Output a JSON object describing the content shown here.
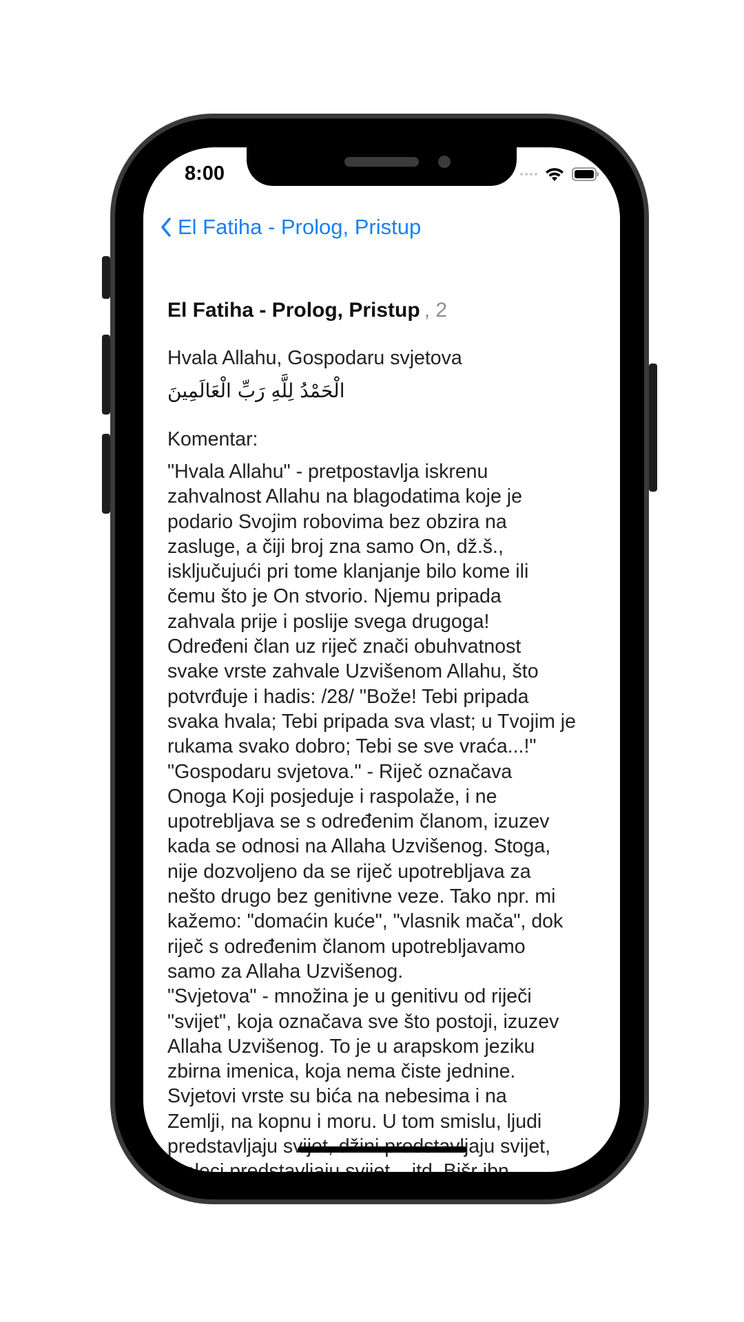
{
  "status_bar": {
    "time": "8:00"
  },
  "nav": {
    "back_label": "El Fatiha - Prolog, Pristup"
  },
  "verse": {
    "title": "El Fatiha - Prolog, Pristup",
    "number": ", 2",
    "translation": "Hvala Allahu, Gospodaru svjetova",
    "arabic": "الْحَمْدُ لِلَّهِ رَبِّ الْعَالَمِينَ"
  },
  "commentary": {
    "label": "Komentar:",
    "text": "\"Hvala Allahu\" - pretpostavlja iskrenu\nzahvalnost Allahu na blagodatima koje je\npodario Svojim robovima bez obzira na\nzasluge, a čiji broj zna samo On, dž.š.,\nisključujući pri tome klanjanje bilo kome ili\nčemu što je On stvorio. Njemu pripada\nzahvala prije i poslije svega drugoga!\nOdređeni član uz riječ  znači obuhvatnost\nsvake vrste zahvale Uzvišenom Allahu, što\npotvrđuje i hadis: /28/ \"Bože! Tebi pripada\nsvaka hvala; Tebi pripada sva vlast; u Tvojim je\nrukama svako dobro; Tebi se sve vraća...!\"\n\"Gospodaru svjetova.\" - Riječ  označava\nOnoga Koji posjeduje i raspolaže, i ne\nupotrebljava se s određenim članom, izuzev\nkada se odnosi na Allaha Uzvišenog. Stoga,\nnije dozvoljeno da se riječ  upotrebljava za\nnešto drugo bez genitivne veze. Tako npr. mi\nkažemo: \"domaćin kuće\", \"vlasnik mača\", dok\nriječ s određenim članom upotrebljavamo\nsamo za Allaha Uzvišenog.\n\"Svjetova\" - množina je u genitivu od riječi\n\"svijet\", koja označava sve što postoji, izuzev\nAllaha Uzvišenog. To je u arapskom jeziku\nzbirna imenica, koja nema čiste jednine.\nSvjetovi  vrste su bića na nebesima i na\nZemlji, na kopnu i moru. U tom smislu, ljudi\npredstavljaju svijet, džini predstavljaju svijet,\nmeleci  predstavljaju svijet... itd. Bišr ibn"
  },
  "colors": {
    "accent": "#1a7ff0",
    "secondary_text": "#8e8e93"
  },
  "icons": {
    "back": "chevron-left-icon",
    "wifi": "wifi-icon",
    "battery": "battery-icon"
  }
}
